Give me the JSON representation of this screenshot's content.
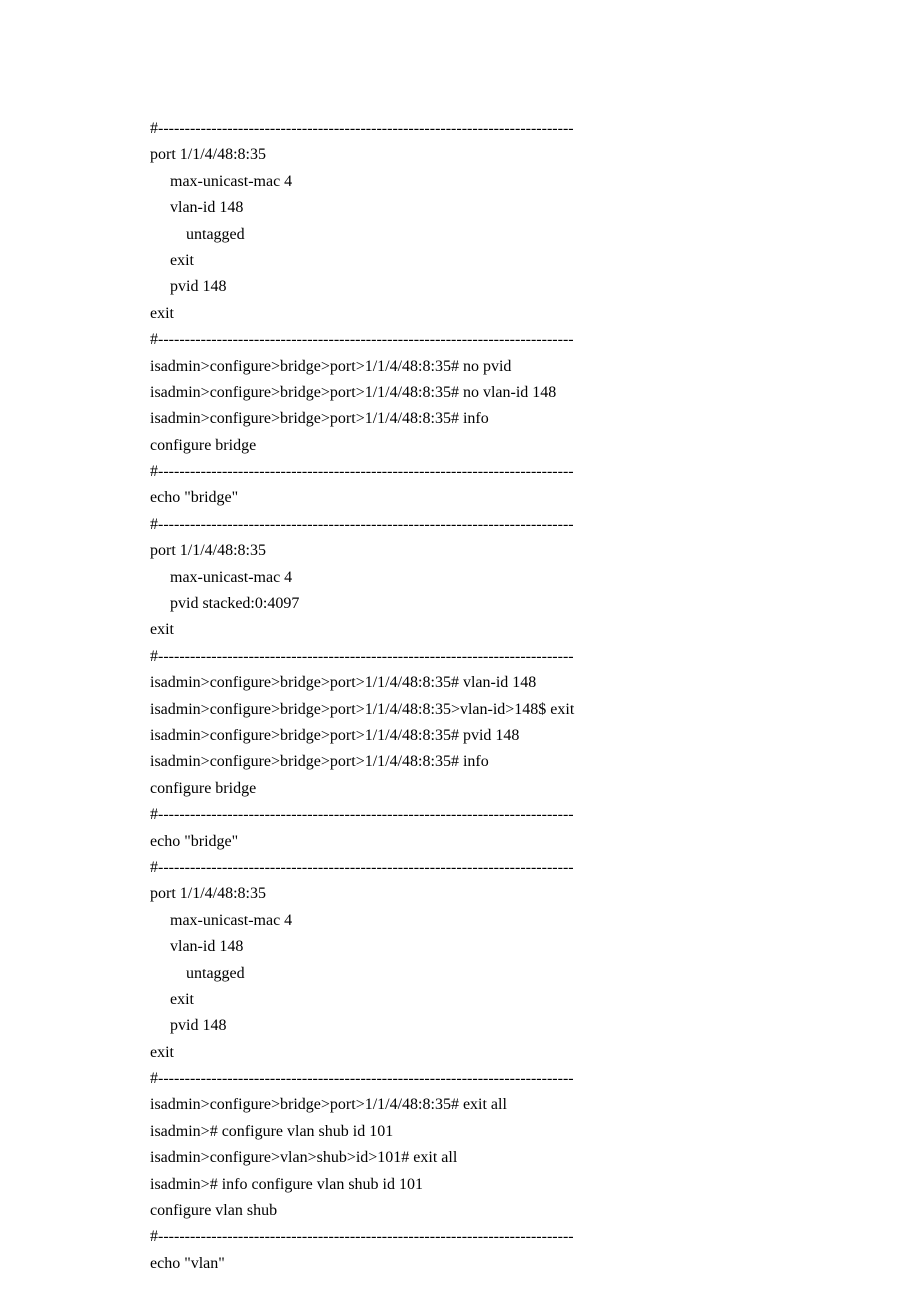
{
  "lines": [
    "#------------------------------------------------------------------------------",
    "port 1/1/4/48:8:35",
    "     max-unicast-mac 4",
    "     vlan-id 148",
    "         untagged",
    "     exit",
    "     pvid 148",
    "exit",
    "#------------------------------------------------------------------------------",
    "isadmin>configure>bridge>port>1/1/4/48:8:35# no pvid",
    "isadmin>configure>bridge>port>1/1/4/48:8:35# no vlan-id 148",
    "isadmin>configure>bridge>port>1/1/4/48:8:35# info",
    "configure bridge",
    "#------------------------------------------------------------------------------",
    "echo \"bridge\"",
    "#------------------------------------------------------------------------------",
    "port 1/1/4/48:8:35",
    "     max-unicast-mac 4",
    "     pvid stacked:0:4097",
    "exit",
    "#------------------------------------------------------------------------------",
    "isadmin>configure>bridge>port>1/1/4/48:8:35# vlan-id 148",
    "isadmin>configure>bridge>port>1/1/4/48:8:35>vlan-id>148$ exit",
    "isadmin>configure>bridge>port>1/1/4/48:8:35# pvid 148",
    "isadmin>configure>bridge>port>1/1/4/48:8:35# info",
    "configure bridge",
    "#------------------------------------------------------------------------------",
    "echo \"bridge\"",
    "#------------------------------------------------------------------------------",
    "port 1/1/4/48:8:35",
    "     max-unicast-mac 4",
    "     vlan-id 148",
    "         untagged",
    "     exit",
    "     pvid 148",
    "exit",
    "#------------------------------------------------------------------------------",
    "isadmin>configure>bridge>port>1/1/4/48:8:35# exit all",
    "isadmin># configure vlan shub id 101",
    "isadmin>configure>vlan>shub>id>101# exit all",
    "isadmin># info configure vlan shub id 101",
    "configure vlan shub",
    "#------------------------------------------------------------------------------",
    "echo \"vlan\""
  ]
}
